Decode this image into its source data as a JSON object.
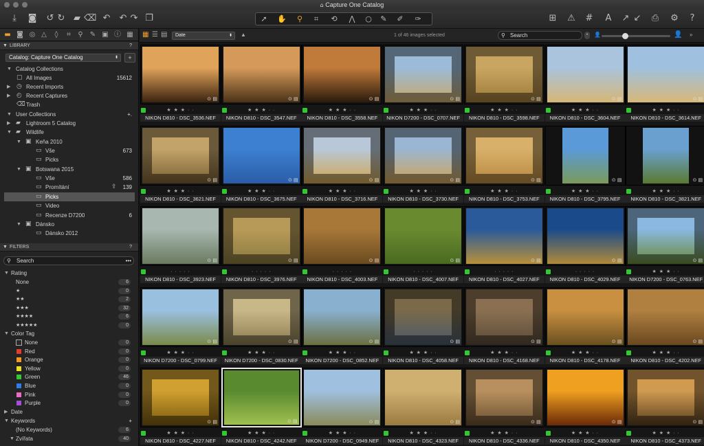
{
  "window": {
    "title": "Capture One Catalog",
    "title_icon": "catalog-icon"
  },
  "toolbar": {
    "left_icons": [
      "import-icon",
      "camera-icon",
      "rotate-left-icon",
      "rotate-right-icon",
      "folder-icon",
      "trash-icon",
      "undo-history-icon",
      "undo-icon",
      "redo-icon",
      "window-icon"
    ],
    "cursor_tools": [
      "select-cursor-icon",
      "pan-icon",
      "zoom-icon",
      "crop-icon",
      "rotate-tool-icon",
      "keystone-icon",
      "circle-mask-icon",
      "brush-icon",
      "color-picker-icon",
      "eraser-icon"
    ],
    "right_icons": [
      "grid-overlay-icon",
      "exposure-warning-icon",
      "guides-icon",
      "text-icon",
      "copy-adjustments-icon",
      "apply-adjustments-icon",
      "print-icon",
      "settings-icon",
      "help-icon"
    ]
  },
  "left": {
    "tool_tabs": [
      "library-icon",
      "capture-icon",
      "lens-icon",
      "color-icon",
      "exposure-icon",
      "details-icon",
      "adjustments-icon",
      "local-icon",
      "output-icon",
      "metadata-icon",
      "batch-icon"
    ],
    "library_header": "LIBRARY",
    "library_q": "?",
    "catalog_select": "Catalog: Capture One Catalog",
    "catalog_add": "+",
    "catalog_collections_label": "Catalog Collections",
    "catalog_collections": [
      {
        "label": "All Images",
        "count": "15612",
        "icon": "all-images-icon"
      },
      {
        "label": "Recent Imports",
        "count": "",
        "icon": "recent-imports-icon"
      },
      {
        "label": "Recent Captures",
        "count": "",
        "icon": "recent-captures-icon"
      },
      {
        "label": "Trash",
        "count": "",
        "icon": "trash-icon"
      }
    ],
    "user_collections_label": "User Collections",
    "user_collections_add": "+.",
    "tree": [
      {
        "label": "Lightroom 5 Catalog",
        "count": ""
      },
      {
        "label": "Wildlife",
        "count": ""
      },
      {
        "label": "Keňa 2010",
        "count": ""
      },
      {
        "label": "Vše",
        "count": "673"
      },
      {
        "label": "Picks",
        "count": ""
      },
      {
        "label": "Botswana 2015",
        "count": ""
      },
      {
        "label": "Vše",
        "count": "586"
      },
      {
        "label": "Promítání",
        "count": "139"
      },
      {
        "label": "Picks",
        "count": ""
      },
      {
        "label": "Video",
        "count": ""
      },
      {
        "label": "Recenze D7200",
        "count": "6"
      },
      {
        "label": "Dánsko",
        "count": ""
      },
      {
        "label": "Dánsko 2012",
        "count": ""
      }
    ],
    "filters_header": "FILTERS",
    "filters_q": "?",
    "filter_search_placeholder": "Search",
    "rating_label": "Rating",
    "ratings": [
      {
        "label": "None",
        "count": "6"
      },
      {
        "label": "★",
        "count": "0"
      },
      {
        "label": "★★",
        "count": "2"
      },
      {
        "label": "★★★",
        "count": "32"
      },
      {
        "label": "★★★★",
        "count": "6"
      },
      {
        "label": "★★★★★",
        "count": "0"
      }
    ],
    "color_tag_label": "Color Tag",
    "color_tags": [
      {
        "label": "None",
        "count": "0",
        "color": "#2a2a2a"
      },
      {
        "label": "Red",
        "count": "0",
        "color": "#e33b2e"
      },
      {
        "label": "Orange",
        "count": "0",
        "color": "#f39a1f"
      },
      {
        "label": "Yellow",
        "count": "0",
        "color": "#eee11c"
      },
      {
        "label": "Green",
        "count": "46",
        "color": "#32c832"
      },
      {
        "label": "Blue",
        "count": "0",
        "color": "#2f7de8"
      },
      {
        "label": "Pink",
        "count": "0",
        "color": "#ec6cc8"
      },
      {
        "label": "Purple",
        "count": "0",
        "color": "#a34fd8"
      }
    ],
    "date_label": "Date",
    "keywords_label": "Keywords",
    "keywords_add": "+",
    "no_keywords": {
      "label": "(No Keywords)",
      "count": "6"
    },
    "zvirata": {
      "label": "Zvířata",
      "count": "40"
    }
  },
  "browser": {
    "sort_value": "Date",
    "image_count": "1 of 46 images selected",
    "search_placeholder": "Search",
    "thumbs": [
      {
        "name": "NIKON D810 - DSC_3536.NEF",
        "stars": "★ ★ ★ · ·",
        "color": "#32c832",
        "c1": "#e0a35a",
        "c2": "#3a2210"
      },
      {
        "name": "NIKON D810 - DSC_3547.NEF",
        "stars": "★ ★ ★ · ·",
        "color": "#32c832",
        "c1": "#d59a5a",
        "c2": "#4a3218"
      },
      {
        "name": "NIKON D810 - DSC_3558.NEF",
        "stars": "★ ★ ★ · ·",
        "color": "#32c832",
        "c1": "#c07a3a",
        "c2": "#2a1a0c"
      },
      {
        "name": "NIKON D7200 - DSC_0707.NEF",
        "stars": "★ ★ ★ · ·",
        "color": "#32c832",
        "c1": "#9bbbd8",
        "c2": "#c8a868"
      },
      {
        "name": "NIKON D810 - DSC_3598.NEF",
        "stars": "★ ★ ★ · ·",
        "color": "#32c832",
        "c1": "#c8a560",
        "c2": "#9e7a3a"
      },
      {
        "name": "NIKON D810 - DSC_3604.NEF",
        "stars": "★ ★ ★ · ·",
        "color": "#32c832",
        "c1": "#a9c4dc",
        "c2": "#d6b676"
      },
      {
        "name": "NIKON D810 - DSC_3614.NEF",
        "stars": "★ ★ ★ · ·",
        "color": "#32c832",
        "c1": "#9fc0de",
        "c2": "#d8b878"
      },
      {
        "name": "NIKON D810 - DSC_3621.NEF",
        "stars": "★ ★ ★ · ·",
        "color": "#32c832",
        "c1": "#c2a46a",
        "c2": "#7a6034"
      },
      {
        "name": "NIKON D810 - DSC_3675.NEF",
        "stars": "★ ★ ★ · ·",
        "color": "#32c832",
        "c1": "#3d7fd0",
        "c2": "#2a5da8"
      },
      {
        "name": "NIKON D810 - DSC_3716.NEF",
        "stars": "★ ★ ★ · ·",
        "color": "#32c832",
        "c1": "#b8c8d8",
        "c2": "#d0a550"
      },
      {
        "name": "NIKON D810 - DSC_3730.NEF",
        "stars": "★ ★ ★ · ·",
        "color": "#32c832",
        "c1": "#9ab6d2",
        "c2": "#d0a458"
      },
      {
        "name": "NIKON D810 - DSC_3753.NEF",
        "stars": "★ ★ ★ · ·",
        "color": "#32c832",
        "c1": "#d8b06a",
        "c2": "#b78840"
      },
      {
        "name": "NIKON D810 - DSC_3795.NEF",
        "stars": "★ ★ ★ · ·",
        "color": "#32c832",
        "c1": "#5a9ad8",
        "c2": "#7a9a5a"
      },
      {
        "name": "NIKON D810 - DSC_3821.NEF",
        "stars": "★ ★ ★ · ·",
        "color": "#32c832",
        "c1": "#6aa0d0",
        "c2": "#5a7a30"
      },
      {
        "name": "NIKON D810 - DSC_3923.NEF",
        "stars": "· · · · ·",
        "color": "#32c832",
        "c1": "#a8b8b0",
        "c2": "#6a7a60"
      },
      {
        "name": "NIKON D810 - DSC_3976.NEF",
        "stars": "· · · · ·",
        "color": "#32c832",
        "c1": "#b89a58",
        "c2": "#8a7a40"
      },
      {
        "name": "NIKON D810 - DSC_4003.NEF",
        "stars": "· · · · ·",
        "color": "#32c832",
        "c1": "#a87838",
        "c2": "#6a4a20"
      },
      {
        "name": "NIKON D810 - DSC_4007.NEF",
        "stars": "· · · · ·",
        "color": "#32c832",
        "c1": "#6a8a30",
        "c2": "#4a6a20"
      },
      {
        "name": "NIKON D810 - DSC_4027.NEF",
        "stars": "· · · · ·",
        "color": "#32c832",
        "c1": "#2a5a9a",
        "c2": "#b8903a"
      },
      {
        "name": "NIKON D810 - DSC_4029.NEF",
        "stars": "· · · · ·",
        "color": "#32c832",
        "c1": "#1a4a8a",
        "c2": "#b08a3a"
      },
      {
        "name": "NIKON D7200 - DSC_0763.NEF",
        "stars": "★ ★ ★ · ·",
        "color": "#32c832",
        "c1": "#8ab8e0",
        "c2": "#6a8a3a"
      },
      {
        "name": "NIKON D7200 - DSC_0799.NEF",
        "stars": "★ ★ ★ · ·",
        "color": "#32c832",
        "c1": "#9ac0e0",
        "c2": "#7a8a4a"
      },
      {
        "name": "NIKON D7200 - DSC_0830.NEF",
        "stars": "★ ★ ★ · ·",
        "color": "#32c832",
        "c1": "#c8b888",
        "c2": "#8a7a50"
      },
      {
        "name": "NIKON D7200 - DSC_0852.NEF",
        "stars": "★ ★ ★ · ·",
        "color": "#32c832",
        "c1": "#8ab0d0",
        "c2": "#6a7040"
      },
      {
        "name": "NIKON D810 - DSC_4058.NEF",
        "stars": "★ ★ ★ · ·",
        "color": "#32c832",
        "c1": "#7a6a4a",
        "c2": "#4a5a6a"
      },
      {
        "name": "NIKON D810 - DSC_4168.NEF",
        "stars": "★ ★ ★ · ·",
        "color": "#32c832",
        "c1": "#8a7050",
        "c2": "#5a4a3a"
      },
      {
        "name": "NIKON D810 - DSC_4178.NEF",
        "stars": "★ ★ ★ · ·",
        "color": "#32c832",
        "c1": "#c89040",
        "c2": "#6a5020"
      },
      {
        "name": "NIKON D810 - DSC_4202.NEF",
        "stars": "★ ★ ★ · ·",
        "color": "#32c832",
        "c1": "#b08040",
        "c2": "#6a4820"
      },
      {
        "name": "NIKON D810 - DSC_4227.NEF",
        "stars": "★ ★ ★ · ·",
        "color": "#32c832",
        "c1": "#d0a030",
        "c2": "#7a5a10"
      },
      {
        "name": "NIKON D810 - DSC_4242.NEF",
        "stars": "★ ★ ★ · ·",
        "color": "#32c832",
        "c1": "#5a8a30",
        "c2": "#a0c050"
      },
      {
        "name": "NIKON D7200 - DSC_0949.NEF",
        "stars": "★ ★ ★ · ·",
        "color": "#32c832",
        "c1": "#a0c0e0",
        "c2": "#8a8a5a"
      },
      {
        "name": "NIKON D810 - DSC_4323.NEF",
        "stars": "★ ★ ★ · ·",
        "color": "#32c832",
        "c1": "#d0b070",
        "c2": "#9a7a40"
      },
      {
        "name": "NIKON D810 - DSC_4336.NEF",
        "stars": "★ ★ ★ · ·",
        "color": "#32c832",
        "c1": "#b89060",
        "c2": "#6a5030"
      },
      {
        "name": "NIKON D810 - DSC_4350.NEF",
        "stars": "★ ★ ★ · ·",
        "color": "#32c832",
        "c1": "#f0a020",
        "c2": "#6a2a08"
      },
      {
        "name": "NIKON D810 - DSC_4373.NEF",
        "stars": "★ ★ ★ · ·",
        "color": "#32c832",
        "c1": "#d09a50",
        "c2": "#5a4020"
      }
    ]
  }
}
